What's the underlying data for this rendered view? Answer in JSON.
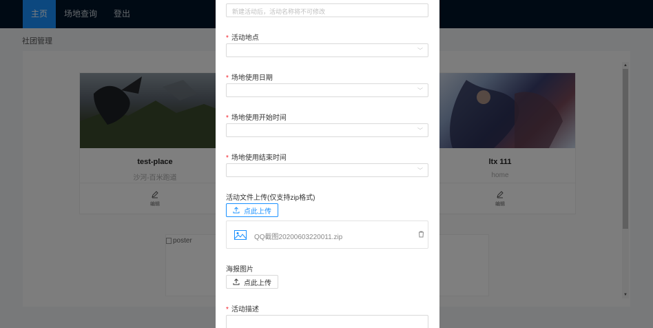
{
  "nav": {
    "items": [
      {
        "label": "主页",
        "active": true
      },
      {
        "label": "场地查询",
        "active": false
      },
      {
        "label": "登出",
        "active": false
      }
    ]
  },
  "breadcrumb": "社团管理",
  "cards": [
    {
      "title": "test-place",
      "subtitle": "沙河-百米跑道",
      "edit_label": "编辑"
    },
    {
      "title": "ltx 111",
      "subtitle": "home",
      "edit_label": "编辑"
    }
  ],
  "poster_alt": "poster",
  "modal": {
    "name_placeholder": "新建活动后，活动名称将不可修改",
    "location_label": "活动地点",
    "date_label": "场地使用日期",
    "start_label": "场地使用开始时间",
    "end_label": "场地使用结束时间",
    "file_upload_label": "活动文件上传(仅支持zip格式)",
    "upload_button_label": "点此上传",
    "file_name": "QQ截图20200603220011.zip",
    "poster_label": "海报图片",
    "poster_upload_label": "点此上传",
    "description_label": "活动描述"
  },
  "colors": {
    "nav_bg": "#001529",
    "accent": "#1890ff",
    "required": "#f5222d"
  }
}
